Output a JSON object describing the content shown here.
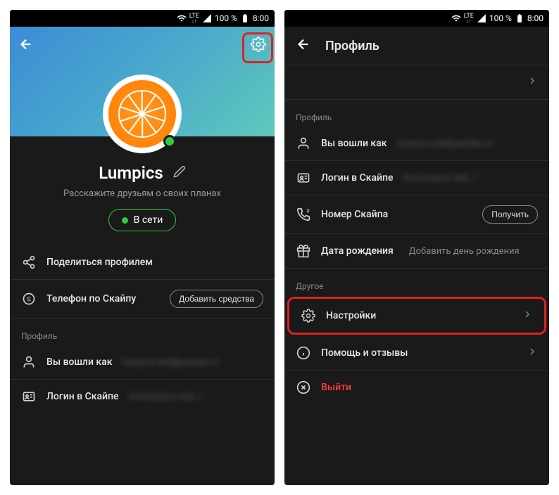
{
  "statusbar": {
    "battery": "100 %",
    "time": "8:00",
    "network": "LTE"
  },
  "left": {
    "name": "Lumpics",
    "tagline": "Расскажите друзьям о своих планах",
    "status_label": "В сети",
    "share_profile": "Поделиться профилем",
    "phone_skype": "Телефон по Скайпу",
    "add_funds": "Добавить средства",
    "section_profile": "Профиль",
    "logged_in_as": "Вы вошли как",
    "logged_in_value": "lumpics.site@yandex.ru",
    "skype_login": "Логин в Скайпе",
    "skype_login_value": "live:lumpics.site_1"
  },
  "right": {
    "title": "Профиль",
    "section_profile": "Профиль",
    "logged_in_as": "Вы вошли как",
    "logged_in_value": "lumpics.site@yandex.ru",
    "skype_login": "Логин в Скайпе",
    "skype_login_value": "live:lumpics.site_1",
    "skype_number": "Номер Скайпа",
    "get_label": "Получить",
    "birthday": "Дата рождения",
    "birthday_value": "Добавить день рождения",
    "section_other": "Другое",
    "settings": "Настройки",
    "help": "Помощь и отзывы",
    "exit": "Выйти"
  }
}
